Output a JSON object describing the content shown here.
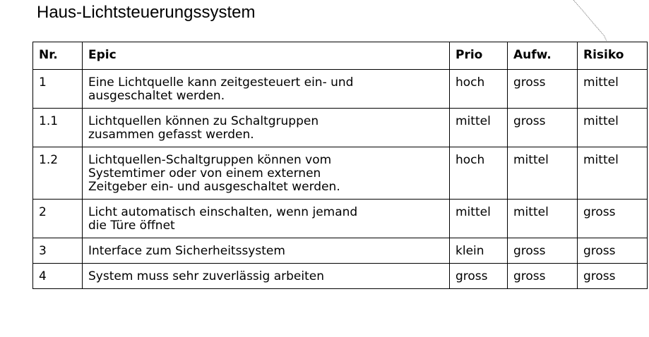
{
  "title": "Haus-Lichtsteuerungssystem",
  "table": {
    "headers": {
      "nr": "Nr.",
      "epic": "Epic",
      "prio": "Prio",
      "aufw": "Aufw.",
      "risiko": "Risiko"
    },
    "rows": [
      {
        "nr": "1",
        "epic_line1": "Eine Lichtquelle kann zeitgesteuert ein- und",
        "epic_line2": "ausgeschaltet werden.",
        "epic_line3": "",
        "prio": "hoch",
        "aufw": "gross",
        "risiko": "mittel"
      },
      {
        "nr": "1.1",
        "epic_line1": "Lichtquellen können zu Schaltgruppen",
        "epic_line2": "zusammen gefasst werden.",
        "epic_line3": "",
        "prio": "mittel",
        "aufw": "gross",
        "risiko": "mittel"
      },
      {
        "nr": "1.2",
        "epic_line1": "Lichtquellen-Schaltgruppen können vom",
        "epic_line2": "Systemtimer oder von einem externen",
        "epic_line3": "Zeitgeber ein- und ausgeschaltet werden.",
        "prio": "hoch",
        "aufw": "mittel",
        "risiko": "mittel"
      },
      {
        "nr": "2",
        "epic_line1": "Licht automatisch einschalten, wenn jemand",
        "epic_line2": "die Türe öffnet",
        "epic_line3": "",
        "prio": "mittel",
        "aufw": "mittel",
        "risiko": "gross"
      },
      {
        "nr": "3",
        "epic_line1": "Interface zum Sicherheitssystem",
        "epic_line2": "",
        "epic_line3": "",
        "prio": "klein",
        "aufw": "gross",
        "risiko": "gross"
      },
      {
        "nr": "4",
        "epic_line1": "System muss sehr zuverlässig arbeiten",
        "epic_line2": "",
        "epic_line3": "",
        "prio": "gross",
        "aufw": "gross",
        "risiko": "gross"
      }
    ]
  }
}
